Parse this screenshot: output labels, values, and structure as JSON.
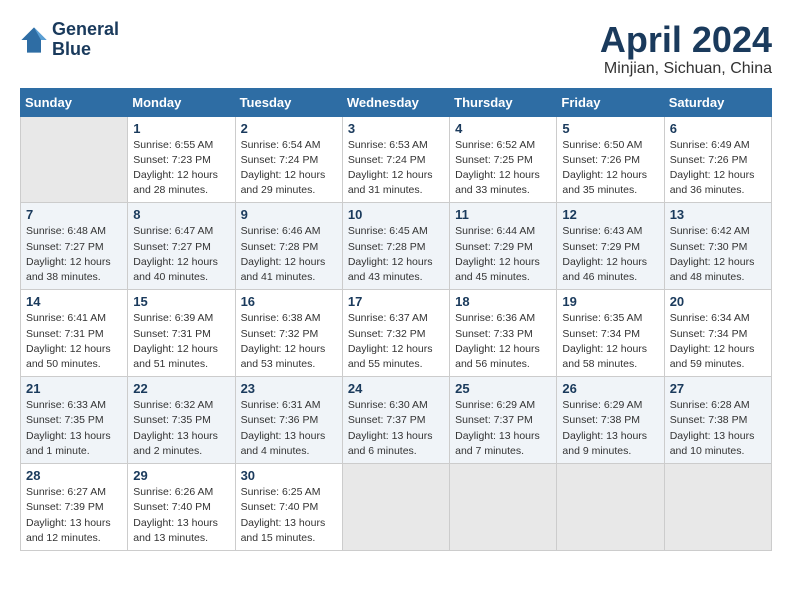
{
  "header": {
    "logo_line1": "General",
    "logo_line2": "Blue",
    "month": "April 2024",
    "location": "Minjian, Sichuan, China"
  },
  "weekdays": [
    "Sunday",
    "Monday",
    "Tuesday",
    "Wednesday",
    "Thursday",
    "Friday",
    "Saturday"
  ],
  "weeks": [
    [
      {
        "day": "",
        "info": ""
      },
      {
        "day": "1",
        "info": "Sunrise: 6:55 AM\nSunset: 7:23 PM\nDaylight: 12 hours\nand 28 minutes."
      },
      {
        "day": "2",
        "info": "Sunrise: 6:54 AM\nSunset: 7:24 PM\nDaylight: 12 hours\nand 29 minutes."
      },
      {
        "day": "3",
        "info": "Sunrise: 6:53 AM\nSunset: 7:24 PM\nDaylight: 12 hours\nand 31 minutes."
      },
      {
        "day": "4",
        "info": "Sunrise: 6:52 AM\nSunset: 7:25 PM\nDaylight: 12 hours\nand 33 minutes."
      },
      {
        "day": "5",
        "info": "Sunrise: 6:50 AM\nSunset: 7:26 PM\nDaylight: 12 hours\nand 35 minutes."
      },
      {
        "day": "6",
        "info": "Sunrise: 6:49 AM\nSunset: 7:26 PM\nDaylight: 12 hours\nand 36 minutes."
      }
    ],
    [
      {
        "day": "7",
        "info": "Sunrise: 6:48 AM\nSunset: 7:27 PM\nDaylight: 12 hours\nand 38 minutes."
      },
      {
        "day": "8",
        "info": "Sunrise: 6:47 AM\nSunset: 7:27 PM\nDaylight: 12 hours\nand 40 minutes."
      },
      {
        "day": "9",
        "info": "Sunrise: 6:46 AM\nSunset: 7:28 PM\nDaylight: 12 hours\nand 41 minutes."
      },
      {
        "day": "10",
        "info": "Sunrise: 6:45 AM\nSunset: 7:28 PM\nDaylight: 12 hours\nand 43 minutes."
      },
      {
        "day": "11",
        "info": "Sunrise: 6:44 AM\nSunset: 7:29 PM\nDaylight: 12 hours\nand 45 minutes."
      },
      {
        "day": "12",
        "info": "Sunrise: 6:43 AM\nSunset: 7:29 PM\nDaylight: 12 hours\nand 46 minutes."
      },
      {
        "day": "13",
        "info": "Sunrise: 6:42 AM\nSunset: 7:30 PM\nDaylight: 12 hours\nand 48 minutes."
      }
    ],
    [
      {
        "day": "14",
        "info": "Sunrise: 6:41 AM\nSunset: 7:31 PM\nDaylight: 12 hours\nand 50 minutes."
      },
      {
        "day": "15",
        "info": "Sunrise: 6:39 AM\nSunset: 7:31 PM\nDaylight: 12 hours\nand 51 minutes."
      },
      {
        "day": "16",
        "info": "Sunrise: 6:38 AM\nSunset: 7:32 PM\nDaylight: 12 hours\nand 53 minutes."
      },
      {
        "day": "17",
        "info": "Sunrise: 6:37 AM\nSunset: 7:32 PM\nDaylight: 12 hours\nand 55 minutes."
      },
      {
        "day": "18",
        "info": "Sunrise: 6:36 AM\nSunset: 7:33 PM\nDaylight: 12 hours\nand 56 minutes."
      },
      {
        "day": "19",
        "info": "Sunrise: 6:35 AM\nSunset: 7:34 PM\nDaylight: 12 hours\nand 58 minutes."
      },
      {
        "day": "20",
        "info": "Sunrise: 6:34 AM\nSunset: 7:34 PM\nDaylight: 12 hours\nand 59 minutes."
      }
    ],
    [
      {
        "day": "21",
        "info": "Sunrise: 6:33 AM\nSunset: 7:35 PM\nDaylight: 13 hours\nand 1 minute."
      },
      {
        "day": "22",
        "info": "Sunrise: 6:32 AM\nSunset: 7:35 PM\nDaylight: 13 hours\nand 2 minutes."
      },
      {
        "day": "23",
        "info": "Sunrise: 6:31 AM\nSunset: 7:36 PM\nDaylight: 13 hours\nand 4 minutes."
      },
      {
        "day": "24",
        "info": "Sunrise: 6:30 AM\nSunset: 7:37 PM\nDaylight: 13 hours\nand 6 minutes."
      },
      {
        "day": "25",
        "info": "Sunrise: 6:29 AM\nSunset: 7:37 PM\nDaylight: 13 hours\nand 7 minutes."
      },
      {
        "day": "26",
        "info": "Sunrise: 6:29 AM\nSunset: 7:38 PM\nDaylight: 13 hours\nand 9 minutes."
      },
      {
        "day": "27",
        "info": "Sunrise: 6:28 AM\nSunset: 7:38 PM\nDaylight: 13 hours\nand 10 minutes."
      }
    ],
    [
      {
        "day": "28",
        "info": "Sunrise: 6:27 AM\nSunset: 7:39 PM\nDaylight: 13 hours\nand 12 minutes."
      },
      {
        "day": "29",
        "info": "Sunrise: 6:26 AM\nSunset: 7:40 PM\nDaylight: 13 hours\nand 13 minutes."
      },
      {
        "day": "30",
        "info": "Sunrise: 6:25 AM\nSunset: 7:40 PM\nDaylight: 13 hours\nand 15 minutes."
      },
      {
        "day": "",
        "info": ""
      },
      {
        "day": "",
        "info": ""
      },
      {
        "day": "",
        "info": ""
      },
      {
        "day": "",
        "info": ""
      }
    ]
  ]
}
